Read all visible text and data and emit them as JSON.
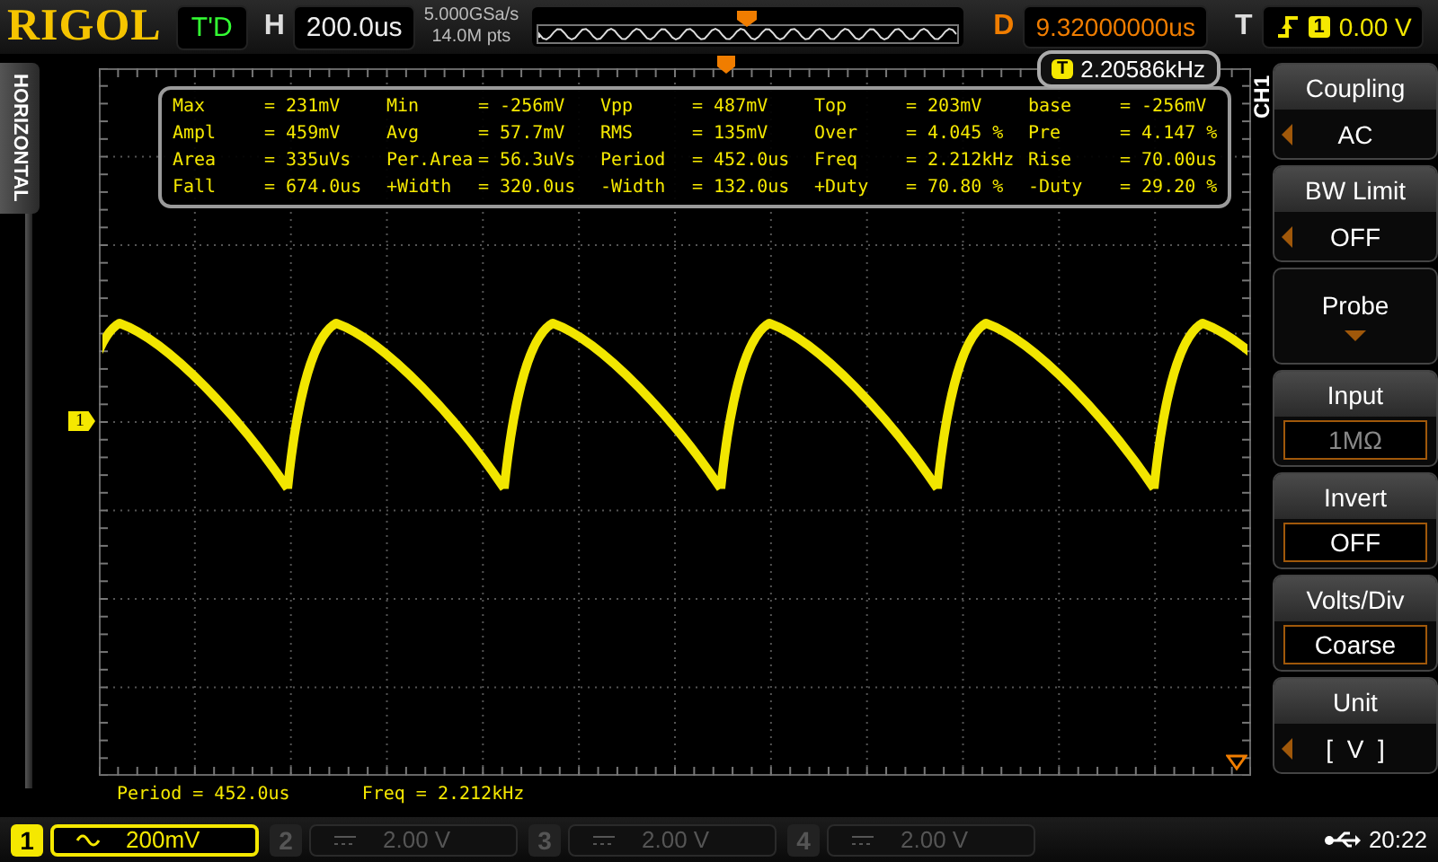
{
  "brand": "RIGOL",
  "trigger_status": "T'D",
  "horizontal": {
    "label": "H",
    "timebase": "200.0us",
    "sample_rate": "5.000GSa/s",
    "memory_depth": "14.0M pts"
  },
  "delay": {
    "label": "D",
    "value": "9.32000000us"
  },
  "trigger": {
    "label": "T",
    "source": "1",
    "level": "0.00 V"
  },
  "side_tab": "HORIZONTAL",
  "channel_tab": "CH1",
  "channel_marker": "1",
  "frequency_counter": {
    "badge": "T",
    "value": "2.20586kHz"
  },
  "measurements": [
    {
      "name": "Max",
      "value": "= 231mV"
    },
    {
      "name": "Min",
      "value": "= -256mV"
    },
    {
      "name": "Vpp",
      "value": "= 487mV"
    },
    {
      "name": "Top",
      "value": "= 203mV"
    },
    {
      "name": "base",
      "value": "= -256mV"
    },
    {
      "name": "Ampl",
      "value": "= 459mV"
    },
    {
      "name": "Avg",
      "value": "= 57.7mV"
    },
    {
      "name": "RMS",
      "value": "= 135mV"
    },
    {
      "name": "Over",
      "value": "= 4.045 %"
    },
    {
      "name": "Pre",
      "value": "= 4.147 %"
    },
    {
      "name": "Area",
      "value": "= 335uVs"
    },
    {
      "name": "Per.Area",
      "value": "= 56.3uVs"
    },
    {
      "name": "Period",
      "value": "= 452.0us"
    },
    {
      "name": "Freq",
      "value": "= 2.212kHz"
    },
    {
      "name": "Rise",
      "value": "= 70.00us"
    },
    {
      "name": "Fall",
      "value": "= 674.0us"
    },
    {
      "name": "+Width",
      "value": "= 320.0us"
    },
    {
      "name": "-Width",
      "value": "= 132.0us"
    },
    {
      "name": "+Duty",
      "value": "= 70.80 %"
    },
    {
      "name": "-Duty",
      "value": "= 29.20 %"
    }
  ],
  "menu": [
    {
      "kind": "select",
      "title": "Coupling",
      "value": "AC",
      "disabled": false
    },
    {
      "kind": "select",
      "title": "BW Limit",
      "value": "OFF",
      "disabled": false
    },
    {
      "kind": "submenu",
      "title": "Probe",
      "disabled": false
    },
    {
      "kind": "boxed",
      "title": "Input",
      "value": "1MΩ",
      "disabled": true
    },
    {
      "kind": "boxed",
      "title": "Invert",
      "value": "OFF",
      "disabled": false
    },
    {
      "kind": "boxed",
      "title": "Volts/Div",
      "value": "Coarse",
      "disabled": false
    },
    {
      "kind": "select",
      "title": "Unit",
      "value": "[  V  ]",
      "disabled": false
    }
  ],
  "bottom_measurements": [
    "Period = 452.0us",
    "Freq = 2.212kHz"
  ],
  "channels": [
    {
      "number": "1",
      "selected": true,
      "kind": "ac",
      "scale": "200mV"
    },
    {
      "number": "2",
      "selected": false,
      "kind": "dc",
      "scale": "2.00 V"
    },
    {
      "number": "3",
      "selected": false,
      "kind": "dc",
      "scale": "2.00 V"
    },
    {
      "number": "4",
      "selected": false,
      "kind": "dc",
      "scale": "2.00 V"
    }
  ],
  "clock": "20:22"
}
